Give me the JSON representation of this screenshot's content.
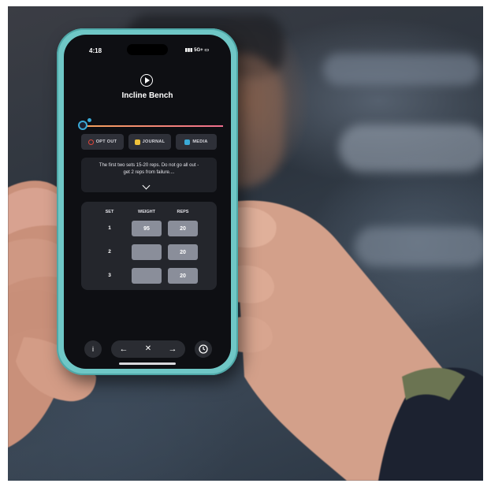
{
  "status_bar": {
    "time": "4:18",
    "signal": "5G+"
  },
  "workout": {
    "title": "Incline Bench"
  },
  "actions": [
    {
      "label": "OPT OUT",
      "icon": "block-icon",
      "color": "#e0453b"
    },
    {
      "label": "JOURNAL",
      "icon": "journal-icon",
      "color": "#f0c23b"
    },
    {
      "label": "MEDIA",
      "icon": "media-icon",
      "color": "#3aaad7"
    }
  ],
  "note": {
    "line1": "The first two sets 15-20 reps. Do not go all out -",
    "line2": "get 2 reps from failure...."
  },
  "table": {
    "headers": {
      "set": "SET",
      "weight": "WEIGHT",
      "reps": "REPS"
    },
    "rows": [
      {
        "set": "1",
        "weight": "95",
        "reps": "20"
      },
      {
        "set": "2",
        "weight": "",
        "reps": "20"
      },
      {
        "set": "3",
        "weight": "",
        "reps": "20"
      }
    ]
  },
  "bottom": {
    "info": "i",
    "back": "←",
    "close": "✕",
    "forward": "→"
  },
  "colors": {
    "phone_case": "#6fc7c6",
    "progress_start": "#f5a25a",
    "progress_end": "#f06e8e",
    "accent": "#3aaad7"
  }
}
